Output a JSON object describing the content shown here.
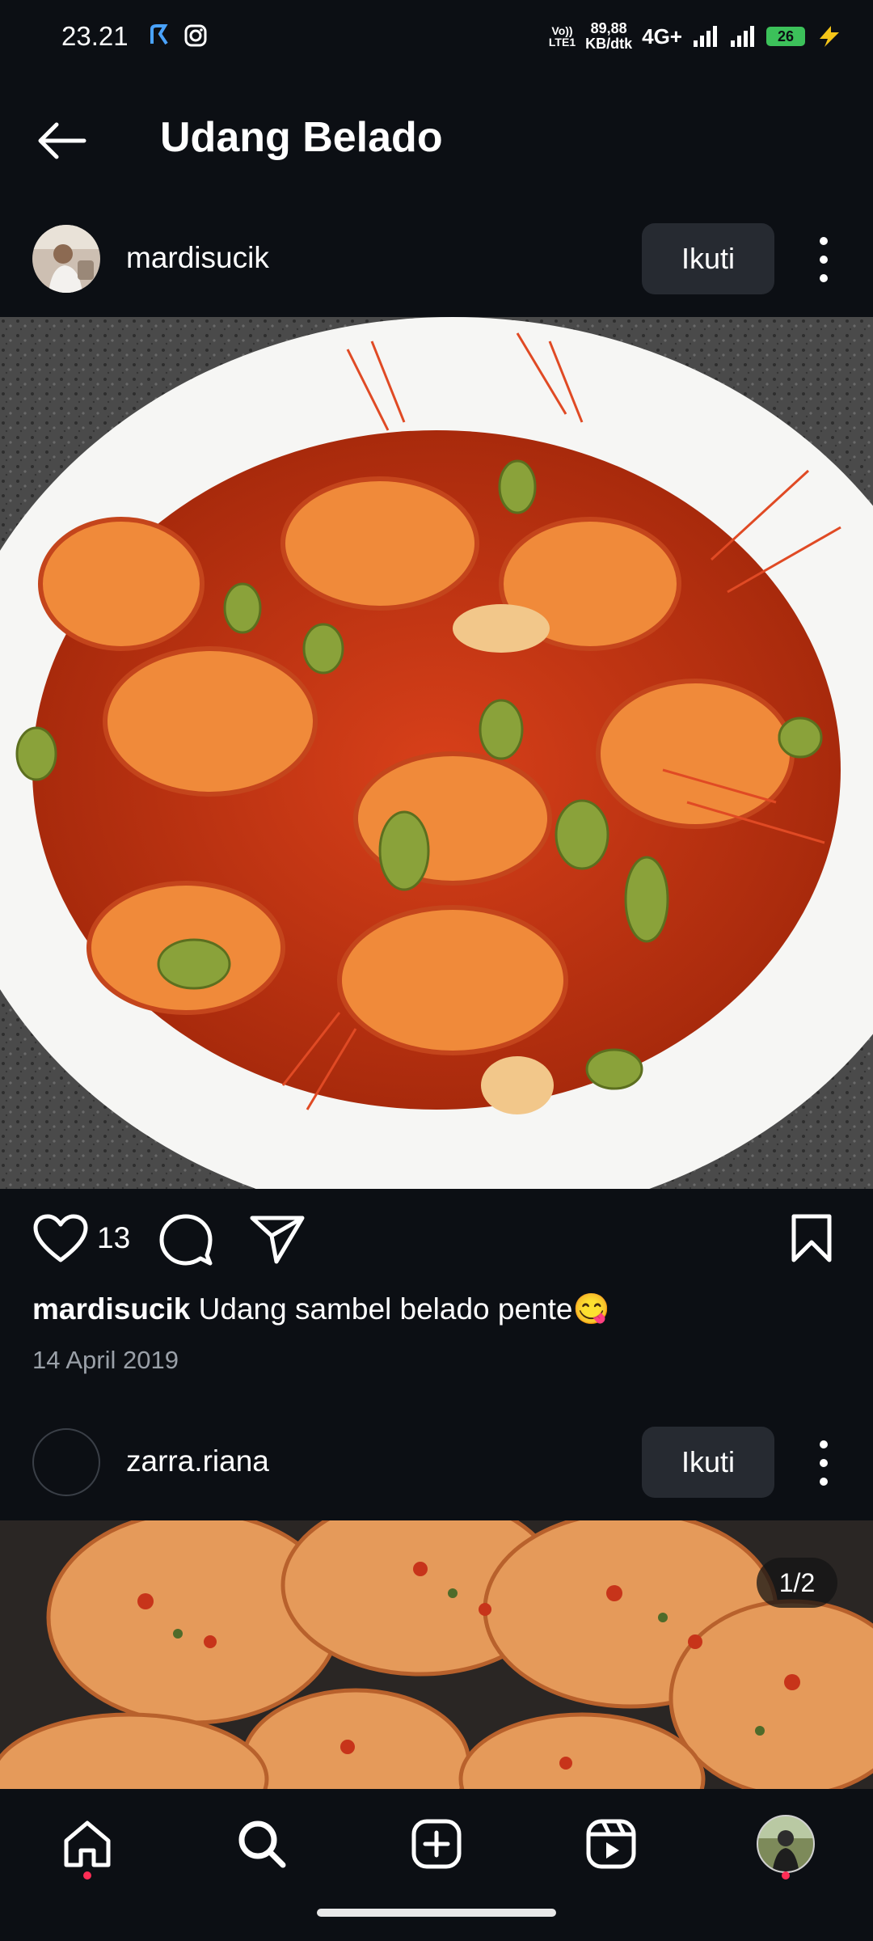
{
  "status_bar": {
    "time": "23.21",
    "volte": [
      "Vo))",
      "LTE1"
    ],
    "net_speed": [
      "89,88",
      "KB/dtk"
    ],
    "network": "4G+",
    "battery": "26"
  },
  "header": {
    "title": "Udang Belado"
  },
  "posts": [
    {
      "username": "mardisucik",
      "follow_label": "Ikuti",
      "likes": "13",
      "caption_user": "mardisucik",
      "caption_text": " Udang sambel belado pente😋",
      "date": "14 April 2019"
    },
    {
      "username": "zarra.riana",
      "follow_label": "Ikuti",
      "image_counter": "1/2"
    }
  ],
  "bottom_nav": {
    "items": [
      "home",
      "search",
      "create",
      "reels",
      "profile"
    ]
  },
  "colors": {
    "background": "#0c0f14",
    "button_bg": "#262a31",
    "notification_dot": "#ff2d55",
    "battery": "#3cc15a"
  }
}
